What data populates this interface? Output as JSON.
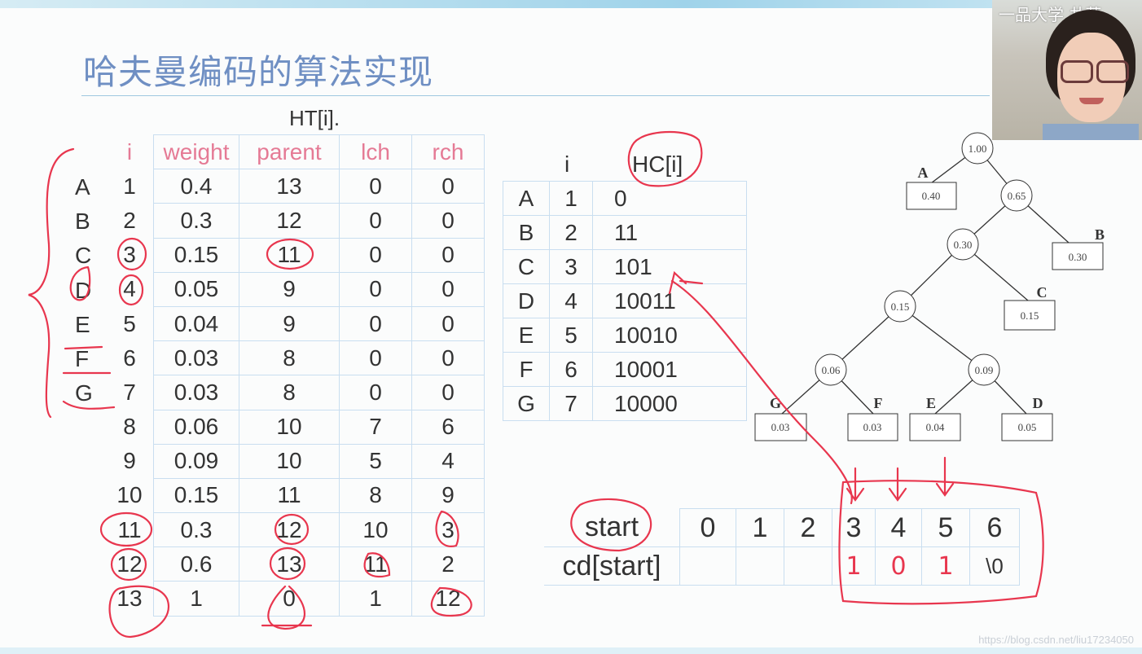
{
  "title": "哈夫曼编码的算法实现",
  "ht_title": "HT[i].",
  "ht_headers": [
    "i",
    "weight",
    "parent",
    "lch",
    "rch"
  ],
  "letters": [
    "A",
    "B",
    "C",
    "D",
    "E",
    "F",
    "G"
  ],
  "ht_rows": [
    [
      "1",
      "0.4",
      "13",
      "0",
      "0"
    ],
    [
      "2",
      "0.3",
      "12",
      "0",
      "0"
    ],
    [
      "3",
      "0.15",
      "11",
      "0",
      "0"
    ],
    [
      "4",
      "0.05",
      "9",
      "0",
      "0"
    ],
    [
      "5",
      "0.04",
      "9",
      "0",
      "0"
    ],
    [
      "6",
      "0.03",
      "8",
      "0",
      "0"
    ],
    [
      "7",
      "0.03",
      "8",
      "0",
      "0"
    ],
    [
      "8",
      "0.06",
      "10",
      "7",
      "6"
    ],
    [
      "9",
      "0.09",
      "10",
      "5",
      "4"
    ],
    [
      "10",
      "0.15",
      "11",
      "8",
      "9"
    ],
    [
      "11",
      "0.3",
      "12",
      "10",
      "3"
    ],
    [
      "12",
      "0.6",
      "13",
      "11",
      "2"
    ],
    [
      "13",
      "1",
      "0",
      "1",
      "12"
    ]
  ],
  "hc_headers": [
    "i",
    "HC[i]"
  ],
  "hc_rows": [
    [
      "A",
      "1",
      "0"
    ],
    [
      "B",
      "2",
      "11"
    ],
    [
      "C",
      "3",
      "101"
    ],
    [
      "D",
      "4",
      "10011"
    ],
    [
      "E",
      "5",
      "10010"
    ],
    [
      "F",
      "6",
      "10001"
    ],
    [
      "G",
      "7",
      "10000"
    ]
  ],
  "tree": {
    "root": "1.00",
    "n065": "0.65",
    "n030": "0.30",
    "n015": "0.15",
    "n006": "0.06",
    "n009": "0.09",
    "leafA": {
      "label": "A",
      "value": "0.40"
    },
    "leafB": {
      "label": "B",
      "value": "0.30"
    },
    "leafC": {
      "label": "C",
      "value": "0.15"
    },
    "leafG": {
      "label": "G",
      "value": "0.03"
    },
    "leafF": {
      "label": "F",
      "value": "0.03"
    },
    "leafE": {
      "label": "E",
      "value": "0.04"
    },
    "leafD": {
      "label": "D",
      "value": "0.05"
    }
  },
  "cd_row1": [
    "start",
    "0",
    "1",
    "2",
    "3",
    "4",
    "5",
    "6"
  ],
  "cd_row2": [
    "cd[start]",
    "",
    "",
    "",
    "1",
    "0",
    "1",
    "\\0"
  ],
  "watermark": "https://blog.csdn.net/liu17234050",
  "webcam_overlay": "一品大学 井草",
  "colors": {
    "title": "#6f8fc3",
    "header": "#e57a95",
    "ink": "#e8364e",
    "grid": "#c9def0"
  }
}
